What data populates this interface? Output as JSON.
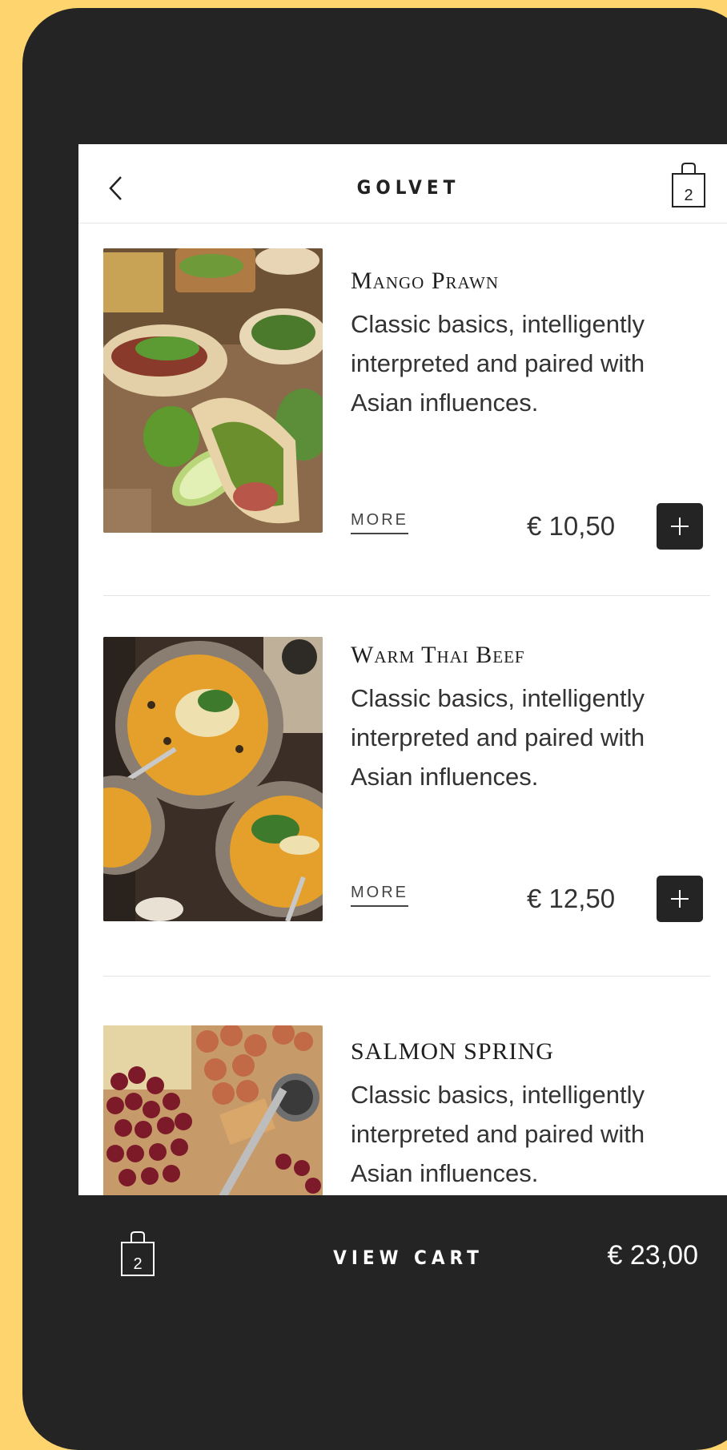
{
  "header": {
    "title": "GOLVET",
    "cart_count": "2"
  },
  "items": [
    {
      "name": "Mango Prawn",
      "description": "Classic basics, intelligently interpreted and paired with Asian influences.",
      "more_label": "MORE",
      "price": "€ 10,50",
      "image_icon": "tacos-photo"
    },
    {
      "name": "Warm Thai Beef",
      "description": "Classic basics, intelligently interpreted and paired with Asian influences.",
      "more_label": "MORE",
      "price": "€ 12,50",
      "image_icon": "soup-photo"
    },
    {
      "name": "SALMON SPRING",
      "description": "Classic basics, intelligently interpreted and paired with Asian influences.",
      "image_icon": "platter-photo"
    }
  ],
  "cart_bar": {
    "count": "2",
    "label": "VIEW CART",
    "total": "€ 23,00"
  },
  "colors": {
    "background": "#fdd46e",
    "device": "#242424",
    "screen": "#ffffff",
    "accent_dark": "#242424"
  }
}
